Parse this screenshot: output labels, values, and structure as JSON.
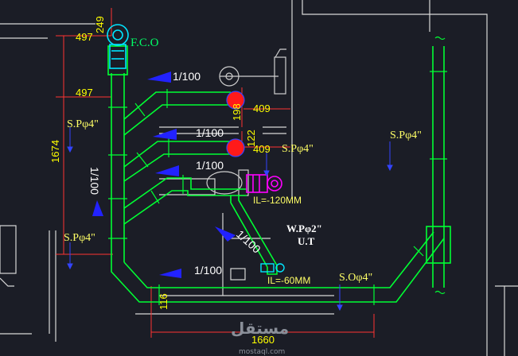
{
  "drawing": {
    "fco_label": "F.C.O",
    "dims": {
      "d249": "249",
      "d497_top": "497",
      "d497_mid": "497",
      "d1674": "1674",
      "d198": "198",
      "d122": "122",
      "d409_top": "409",
      "d409_mid": "409",
      "d116": "116",
      "d1660": "1660"
    },
    "slopes": {
      "s1": "1/100",
      "s2": "1/100",
      "s3": "1/100",
      "s4": "1/100",
      "s5": "1/100",
      "vertical": "1/100",
      "diag": "1/100"
    },
    "pipe_labels": {
      "sp_left_top": "S.Pφ4\"",
      "sp_left_bottom": "S.Pφ4\"",
      "sp_center": "S.Pφ4\"",
      "sp_right": "S.Pφ4\"",
      "wp": "W.Pφ2\"",
      "ut": "U.T",
      "so": "S.Oφ4\""
    },
    "levels": {
      "il_120": "IL=-120MM",
      "il_60": "IL=-60MM"
    },
    "watermark": {
      "arabic": "مستقل",
      "latin": "mostaql.com"
    },
    "colors": {
      "background": "#1b1d26",
      "pipe": "#00ff33",
      "dimension": "#ff3333",
      "text_yellow": "#ffff00",
      "slope_arrow": "#2222ff",
      "drain_red": "#ff1a1a",
      "fixture_magenta": "#ff00ff",
      "fco_cyan": "#00e5ff",
      "wall": "#d8d8d8"
    }
  }
}
